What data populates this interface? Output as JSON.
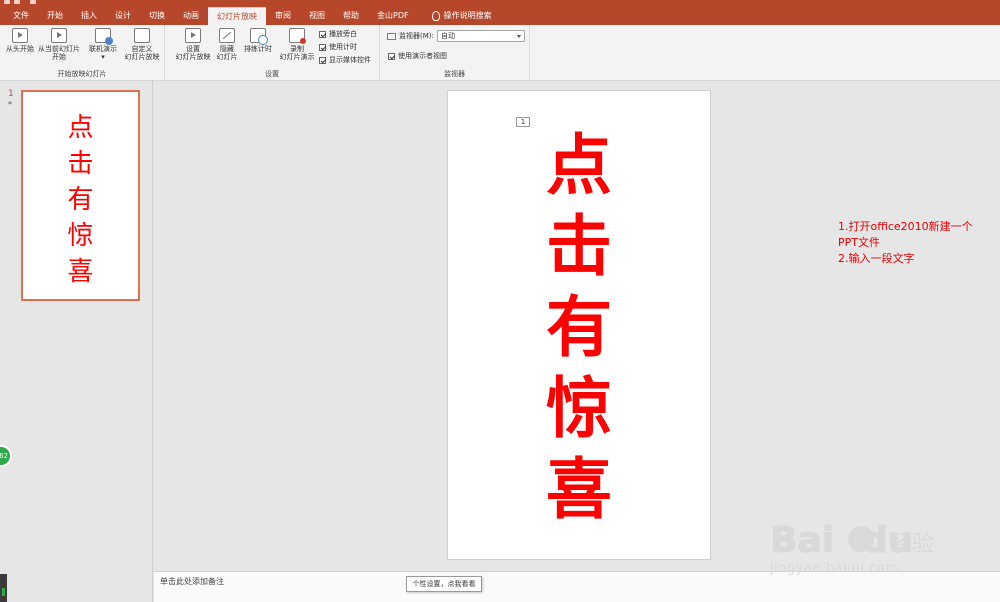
{
  "ribbon_tabs": [
    "文件",
    "开始",
    "插入",
    "设计",
    "切换",
    "动画",
    "幻灯片放映",
    "审阅",
    "视图",
    "帮助",
    "金山PDF",
    "操作说明搜索"
  ],
  "active_tab": "幻灯片放映",
  "groups": {
    "start": {
      "label": "开始放映幻灯片",
      "from_start": "从头开始",
      "from_current_1": "从当前幻灯片",
      "from_current_2": "开始",
      "online": "联机演示",
      "custom_1": "自定义",
      "custom_2": "幻灯片放映"
    },
    "setup": {
      "label": "设置",
      "setup_show_1": "设置",
      "setup_show_2": "幻灯片放映",
      "hide_1": "隐藏",
      "hide_2": "幻灯片",
      "rehearse": "排练计时",
      "record_1": "录制",
      "record_2": "幻灯片演示",
      "play_narrations": "播放旁白",
      "use_timings": "使用计时",
      "show_media": "显示媒体控件"
    },
    "monitors": {
      "label": "监视器",
      "monitor_label": "监视器(M):",
      "monitor_value": "自动",
      "presenter_view": "使用演示者视图"
    }
  },
  "slide": {
    "number": "1",
    "star": "*",
    "placeholder_num": "1",
    "chars": [
      "点",
      "击",
      "有",
      "惊",
      "喜"
    ]
  },
  "annotation_lines": [
    "1.打开office2010新建一个",
    "PPT文件",
    "2.输入一段文字"
  ],
  "notes_placeholder": "单击此处添加备注",
  "tooltip": "个性设置，点我看看",
  "badge": "62",
  "watermark": {
    "brand": "Bai",
    "brand2": "du",
    "cn": "经验",
    "url": "jingyan.baidu.com"
  },
  "colors": {
    "accent": "#b7472a",
    "slide_text": "#ff0000",
    "annotation": "#e60000"
  }
}
